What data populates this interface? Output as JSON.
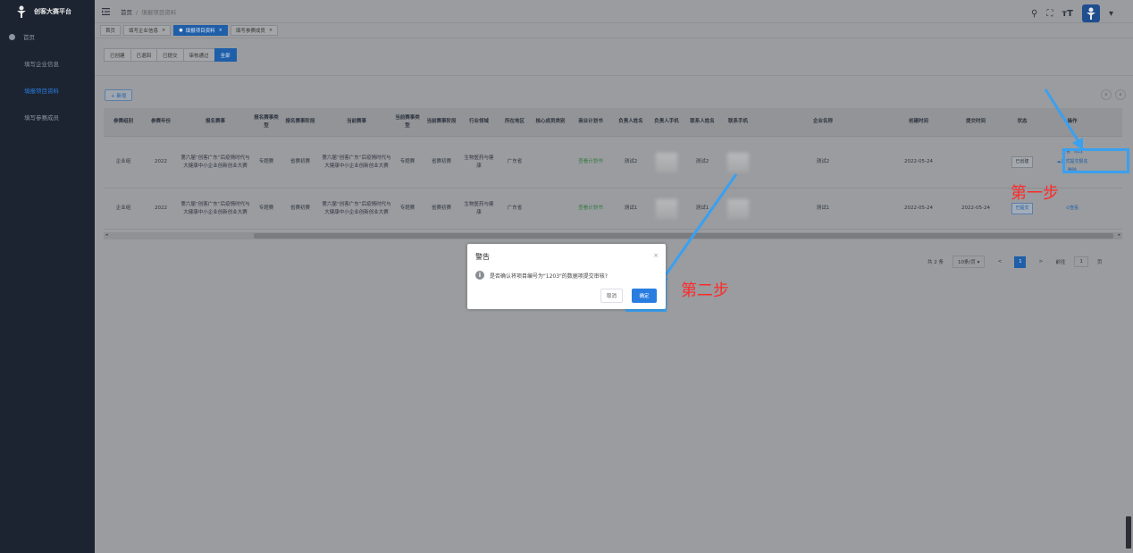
{
  "app": {
    "name": "创客大赛平台"
  },
  "sidebar": {
    "items": [
      {
        "label": "首页"
      },
      {
        "label": "填写企业信息"
      },
      {
        "label": "填报项目资料"
      },
      {
        "label": "填写参赛成员"
      }
    ]
  },
  "breadcrumb": {
    "home": "首页",
    "sep": "/",
    "current": "填报项目资料"
  },
  "tabs": [
    {
      "label": "首页"
    },
    {
      "label": "填写企业信息"
    },
    {
      "label": "填报项目资料"
    },
    {
      "label": "填写参赛成员"
    }
  ],
  "status_filters": [
    {
      "label": "已创建"
    },
    {
      "label": "已退回"
    },
    {
      "label": "已提交"
    },
    {
      "label": "审核通过"
    },
    {
      "label": "全部"
    }
  ],
  "add_button": "+ 新增",
  "table": {
    "headers": [
      "参赛组别",
      "参赛年份",
      "报名赛事",
      "报名赛事类型",
      "报名赛事阶段",
      "当前赛事",
      "当前赛事类型",
      "当前赛事阶段",
      "行业领域",
      "所在地区",
      "核心成员类别",
      "商业计划书",
      "负责人姓名",
      "负责人手机",
      "联系人姓名",
      "联系手机",
      "企业名称",
      "创建时间",
      "提交时间",
      "状态",
      "操作"
    ],
    "rows": [
      {
        "group": "企业组",
        "year": "2022",
        "contest": "第六届“创客广东”后疫情时代与大健康中小企业创新创业大赛",
        "contest_type": "专题赛",
        "contest_stage": "省赛初赛",
        "current": "第六届“创客广东”后疫情时代与大健康中小企业创新创业大赛",
        "current_type": "专题赛",
        "current_stage": "省赛初赛",
        "industry": "生物医药与健康",
        "region": "广东省",
        "core": "",
        "plan": "查看计划书",
        "leader": "测试2",
        "contact": "测试2",
        "company": "测试2",
        "created": "2022-05-24",
        "submitted": "",
        "status": "已创建",
        "ops": [
          "查看",
          "修改",
          "正式提交报名",
          "删除"
        ]
      },
      {
        "group": "企业组",
        "year": "2022",
        "contest": "第六届“创客广东”后疫情时代与大健康中小企业创新创业大赛",
        "contest_type": "专题赛",
        "contest_stage": "省赛初赛",
        "current": "第六届“创客广东”后疫情时代与大健康中小企业创新创业大赛",
        "current_type": "专题赛",
        "current_stage": "省赛初赛",
        "industry": "生物医药与健康",
        "region": "广东省",
        "core": "",
        "plan": "查看计划书",
        "leader": "测试1",
        "contact": "测试1",
        "company": "测试1",
        "created": "2022-05-24",
        "submitted": "2022-05-24",
        "status": "已提交",
        "ops": [
          "查看"
        ]
      }
    ]
  },
  "pagination": {
    "total": "共 2 条",
    "page_size": "10条/页",
    "prev": "<",
    "page": "1",
    "next": ">",
    "goto": "前往",
    "goto_value": "1",
    "page_unit": "页"
  },
  "dialog": {
    "title": "警告",
    "message": "是否确认将项目编号为\"1203\"的数据项提交审核?",
    "cancel": "取消",
    "confirm": "确定"
  },
  "annotations": {
    "step1": "第一步",
    "step2": "第二步"
  },
  "colors": {
    "accent": "#2a7de0",
    "annotation_text": "#ff2a2a",
    "annotation_box": "#3aa0f0"
  }
}
